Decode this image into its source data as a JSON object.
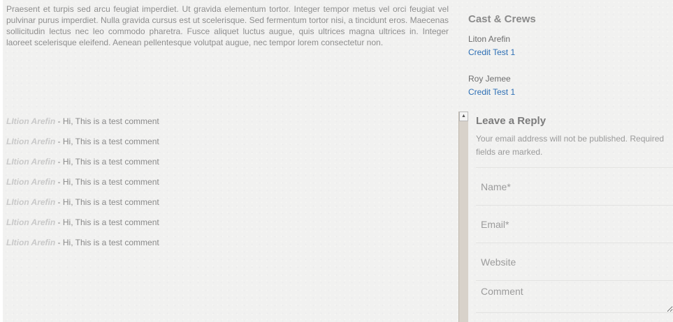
{
  "article": {
    "intro": "Praesent et turpis sed arcu feugiat imperdiet. Ut gravida elementum tortor. Integer tempor metus vel orci feugiat vel pulvinar purus imperdiet. Nulla gravida cursus est ut scelerisque. Sed fermentum tortor nisi, a tincidunt eros. Maecenas sollicitudin lectus nec leo commodo pharetra. Fusce aliquet luctus augue, quis ultrices magna ultrices in. Integer laoreet scelerisque eleifend. Aenean pellentesque volutpat augue, nec tempor lorem consectetur non."
  },
  "comments": [
    {
      "author": "LItion Arefin",
      "text": " - Hi, This is a test comment"
    },
    {
      "author": "LItion Arefin",
      "text": " - Hi, This is a test comment"
    },
    {
      "author": "LItion Arefin",
      "text": " - Hi, This is a test comment"
    },
    {
      "author": "LItion Arefin",
      "text": " - Hi, This is a test comment"
    },
    {
      "author": "LItion Arefin",
      "text": " - Hi, This is a test comment"
    },
    {
      "author": "LItion Arefin",
      "text": " - Hi, This is a test comment"
    },
    {
      "author": "LItion Arefin",
      "text": " - Hi, This is a test comment"
    }
  ],
  "cast": {
    "title": "Cast & Crews",
    "members": [
      {
        "name": "Liton Arefin",
        "credit": "Credit Test 1"
      },
      {
        "name": "Roy Jemee",
        "credit": "Credit Test 1"
      }
    ]
  },
  "reply": {
    "title": "Leave a Reply",
    "note": "Your email address will not be published. Required fields are marked.",
    "name_placeholder": "Name*",
    "email_placeholder": "Email*",
    "website_placeholder": "Website",
    "comment_placeholder": "Comment"
  },
  "icons": {
    "scroll_up": "arrow-up-icon",
    "resize": "resize-grip-icon"
  },
  "colors": {
    "background": "#f1f1f0",
    "link": "#2d6fb5",
    "comment_author": "#c9c9c9",
    "body_text": "#8e8e8e",
    "scrollbar_track": "#d8d2ca"
  }
}
